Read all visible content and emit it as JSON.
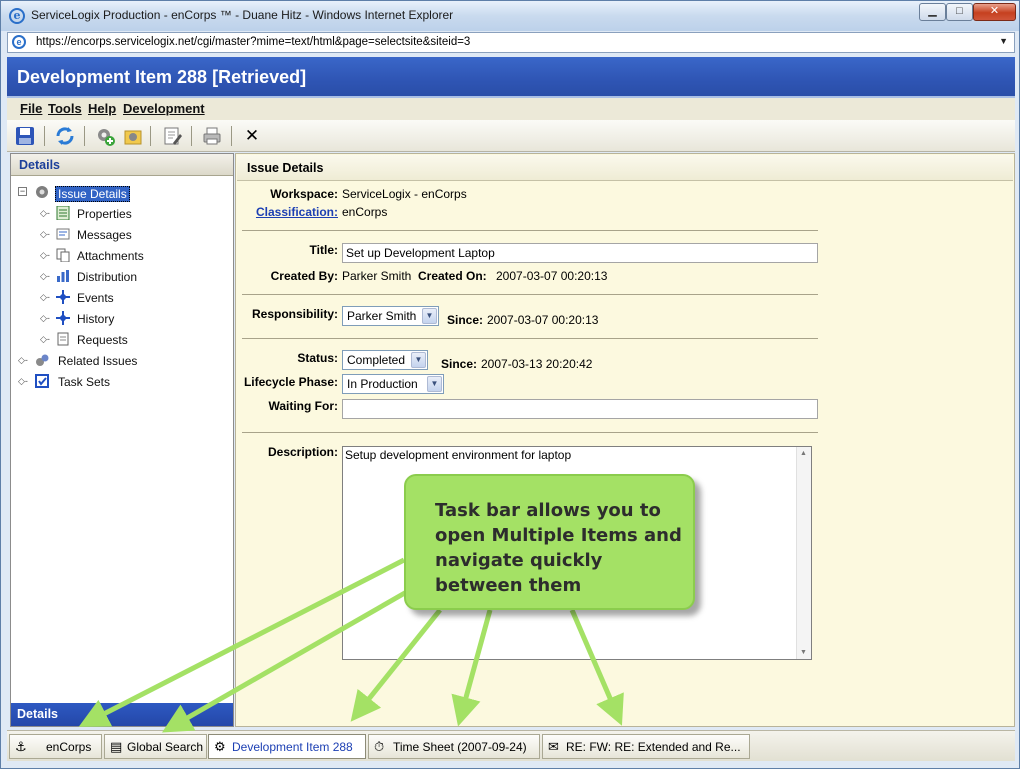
{
  "window": {
    "title": "ServiceLogix Production - enCorps ™ - Duane Hitz - Windows Internet Explorer",
    "url": "https://encorps.servicelogix.net/cgi/master?mime=text/html&page=selectsite&siteid=3"
  },
  "app": {
    "title": "Development Item 288 [Retrieved]"
  },
  "menu": {
    "file": "File",
    "tools": "Tools",
    "help": "Help",
    "development": "Development"
  },
  "toolbar": {
    "close": "✕"
  },
  "left": {
    "header": "Details",
    "footer": "Details",
    "tree": {
      "issue_details": "Issue Details",
      "properties": "Properties",
      "messages": "Messages",
      "attachments": "Attachments",
      "distribution": "Distribution",
      "events": "Events",
      "history": "History",
      "requests": "Requests",
      "related_issues": "Related Issues",
      "task_sets": "Task Sets"
    }
  },
  "issue": {
    "header": "Issue Details",
    "workspace_label": "Workspace:",
    "workspace": "ServiceLogix - enCorps",
    "classification_label": "Classification:",
    "classification": "enCorps",
    "title_label": "Title:",
    "title": "Set up Development Laptop",
    "created_by_label": "Created By:",
    "created_by": "Parker Smith",
    "created_on_label": "Created On:",
    "created_on": "2007-03-07 00:20:13",
    "responsibility_label": "Responsibility:",
    "responsibility": "Parker Smith",
    "since_label": "Since:",
    "responsibility_since": "2007-03-07 00:20:13",
    "status_label": "Status:",
    "status": "Completed",
    "status_since": "2007-03-13 20:20:42",
    "lifecycle_label": "Lifecycle Phase:",
    "lifecycle": "In Production",
    "waiting_label": "Waiting For:",
    "waiting": "",
    "description_label": "Description:",
    "description": "Setup development environment for laptop"
  },
  "callout": {
    "text": "Task bar allows you to open Multiple Items and navigate quickly between them"
  },
  "taskbar": {
    "encorps": "enCorps",
    "global_search": "Global Search",
    "dev_item": "Development Item 288",
    "time_sheet": "Time Sheet (2007-09-24)",
    "email": "RE: FW: RE: Extended and Re..."
  },
  "colors": {
    "header_blue": "#2f55b4",
    "panel_bg": "#fcf9df",
    "callout_green": "#a4e165",
    "link_blue": "#1c3fb3"
  }
}
